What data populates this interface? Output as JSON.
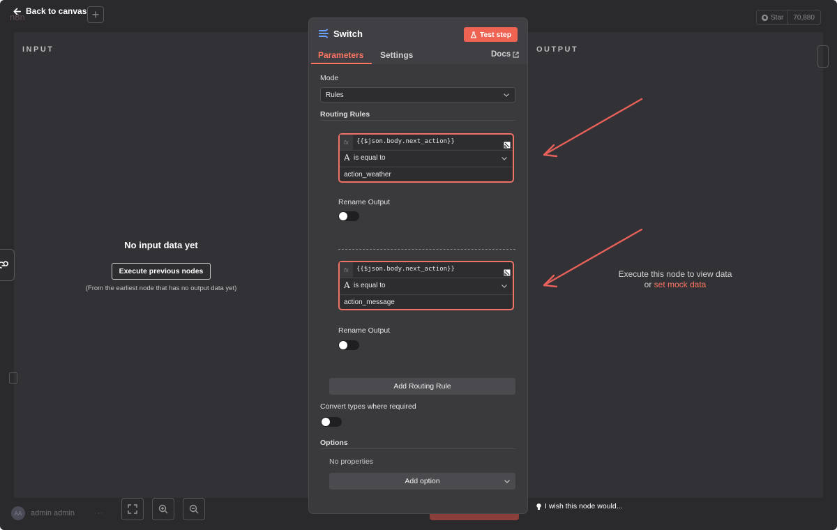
{
  "topbar": {
    "back_label": "Back to canvas",
    "logo_text": "n8n",
    "github_star_label": "Star",
    "github_star_count": "70,880"
  },
  "input_pane": {
    "title": "INPUT",
    "empty_title": "No input data yet",
    "execute_button": "Execute previous nodes",
    "hint": "(From the earliest node that has no output data yet)"
  },
  "output_pane": {
    "title": "OUTPUT",
    "hint_prefix": "Execute this node to view data",
    "hint_or": "or",
    "mock_link": "set mock data"
  },
  "node": {
    "name": "Switch",
    "test_step_label": "Test step",
    "tabs": [
      {
        "label": "Parameters",
        "active": true
      },
      {
        "label": "Settings",
        "active": false
      }
    ],
    "docs_label": "Docs",
    "mode_label": "Mode",
    "mode_value": "Rules",
    "routing_rules_label": "Routing Rules",
    "rules": [
      {
        "fx": "fx",
        "expression": "{{$json.body.next_action}}",
        "type_icon": "A",
        "operator": "is equal to",
        "value": "action_weather",
        "rename_label": "Rename Output",
        "rename_enabled": false
      },
      {
        "fx": "fx",
        "expression": "{{$json.body.next_action}}",
        "type_icon": "A",
        "operator": "is equal to",
        "value": "action_message",
        "rename_label": "Rename Output",
        "rename_enabled": false
      }
    ],
    "add_rule_label": "Add Routing Rule",
    "convert_types_label": "Convert types where required",
    "convert_types_enabled": false,
    "options_label": "Options",
    "no_properties": "No properties",
    "add_option_label": "Add option"
  },
  "bottom": {
    "user_initials": "AA",
    "user_name": "admin admin",
    "wish_label": "I wish this node would..."
  },
  "colors": {
    "accent": "#ff7560",
    "test_button": "#ee6352",
    "highlight_border": "#f0736a",
    "annotation_arrow": "#e8605a"
  }
}
